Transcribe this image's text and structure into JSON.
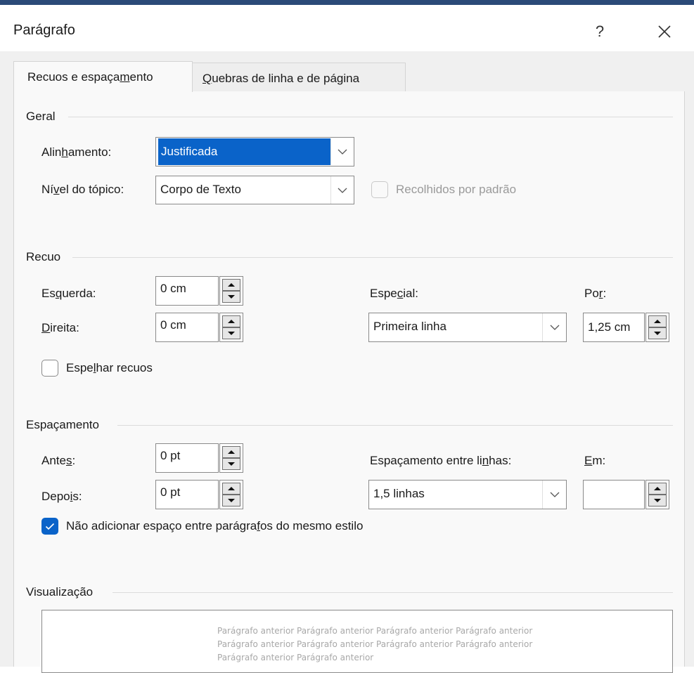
{
  "window": {
    "title": "Parágrafo",
    "help_label": "?",
    "close_icon": "close-icon"
  },
  "tabs": [
    {
      "label_pre": "Recuos e espaça",
      "label_ul": "m",
      "label_post": "ento",
      "active": true
    },
    {
      "label_pre": "",
      "label_ul": "Q",
      "label_post": "uebras de linha e de página",
      "active": false
    }
  ],
  "geral": {
    "header": "Geral",
    "alinhamento": {
      "label_pre": "Alin",
      "label_ul": "h",
      "label_post": "amento:",
      "value": "Justificada"
    },
    "nivel": {
      "label_pre": "Ní",
      "label_ul": "v",
      "label_post": "el do tópico:",
      "value": "Corpo de Texto"
    },
    "recolhidos": {
      "label": "Recolhidos por padrão",
      "checked": false,
      "enabled": false
    }
  },
  "recuo": {
    "header": "Recuo",
    "esquerda": {
      "label_pre": "Es",
      "label_ul": "q",
      "label_post": "uerda:",
      "value": "0 cm"
    },
    "direita": {
      "label_pre": "",
      "label_ul": "D",
      "label_post": "ireita:",
      "value": "0 cm"
    },
    "especial": {
      "label_pre": "Espe",
      "label_ul": "c",
      "label_post": "ial:",
      "value": "Primeira linha"
    },
    "por": {
      "label_pre": "Po",
      "label_ul": "r",
      "label_post": ":",
      "value": "1,25 cm"
    },
    "espelhar": {
      "label_pre": "Espe",
      "label_ul": "l",
      "label_post": "har recuos",
      "checked": false
    }
  },
  "espacamento": {
    "header": "Espaçamento",
    "antes": {
      "label_pre": "Ante",
      "label_ul": "s",
      "label_post": ":",
      "value": "0 pt"
    },
    "depois": {
      "label_pre": "Depo",
      "label_ul": "i",
      "label_post": "s:",
      "value": "0 pt"
    },
    "entre_linhas": {
      "label_pre": "Espaçamento entre li",
      "label_ul": "n",
      "label_post": "has:",
      "value": "1,5 linhas"
    },
    "em": {
      "label_pre": "",
      "label_ul": "E",
      "label_post": "m:",
      "value": ""
    },
    "nao_adicionar": {
      "label_pre": "Não adicionar espaço entre parágra",
      "label_ul": "f",
      "label_post": "os do mesmo estilo",
      "checked": true
    }
  },
  "visualizacao": {
    "header": "Visualização",
    "preview_lines": [
      "Parágrafo anterior Parágrafo anterior Parágrafo anterior Parágrafo anterior",
      "Parágrafo anterior Parágrafo anterior Parágrafo anterior Parágrafo anterior",
      "Parágrafo anterior Parágrafo anterior"
    ]
  },
  "colors": {
    "accent": "#0a63c9",
    "title_bar_top": "#2b4a78"
  }
}
